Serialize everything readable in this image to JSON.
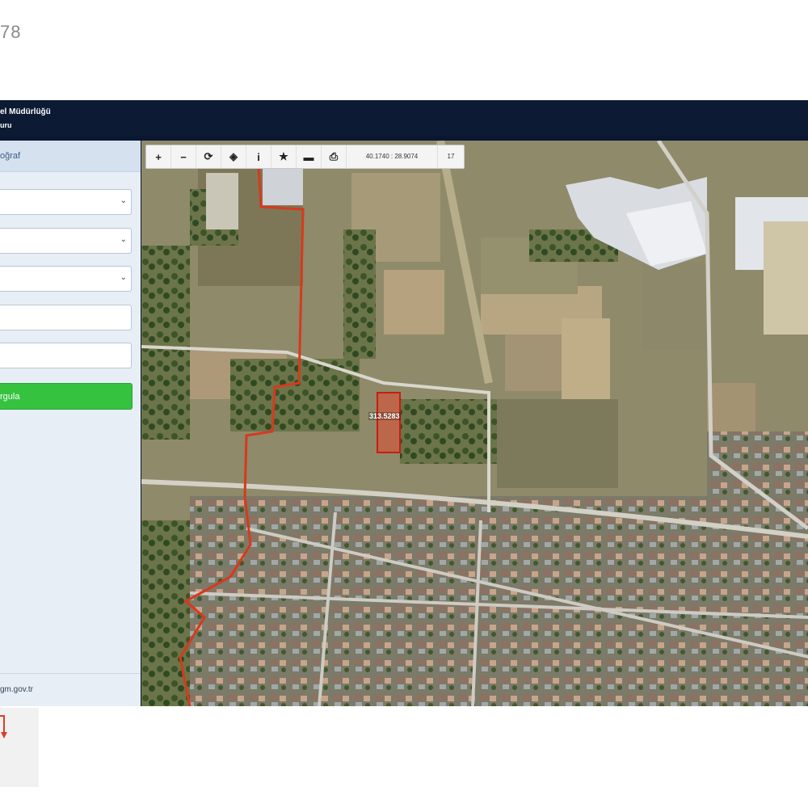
{
  "top_number": "78",
  "header": {
    "title_line1": "el Müdürlüğü",
    "title_line2": "uru"
  },
  "sidebar": {
    "header": "oğraf",
    "button_label": "rgula",
    "footer_link": "gm.gov.tr"
  },
  "toolbar": {
    "coords": "40.1740 : 28.9074",
    "zoom": "17",
    "icons": [
      "zoom-in-icon",
      "zoom-out-icon",
      "refresh-icon",
      "locate-icon",
      "info-icon",
      "star-icon",
      "measure-icon",
      "print-icon"
    ]
  },
  "map": {
    "parcel_label": "313.5283",
    "colors": {
      "boundary": "#d8391d",
      "parcel_fill": "#e2492f",
      "button_green": "#35c33f",
      "header_bg": "#0c1a33"
    }
  }
}
